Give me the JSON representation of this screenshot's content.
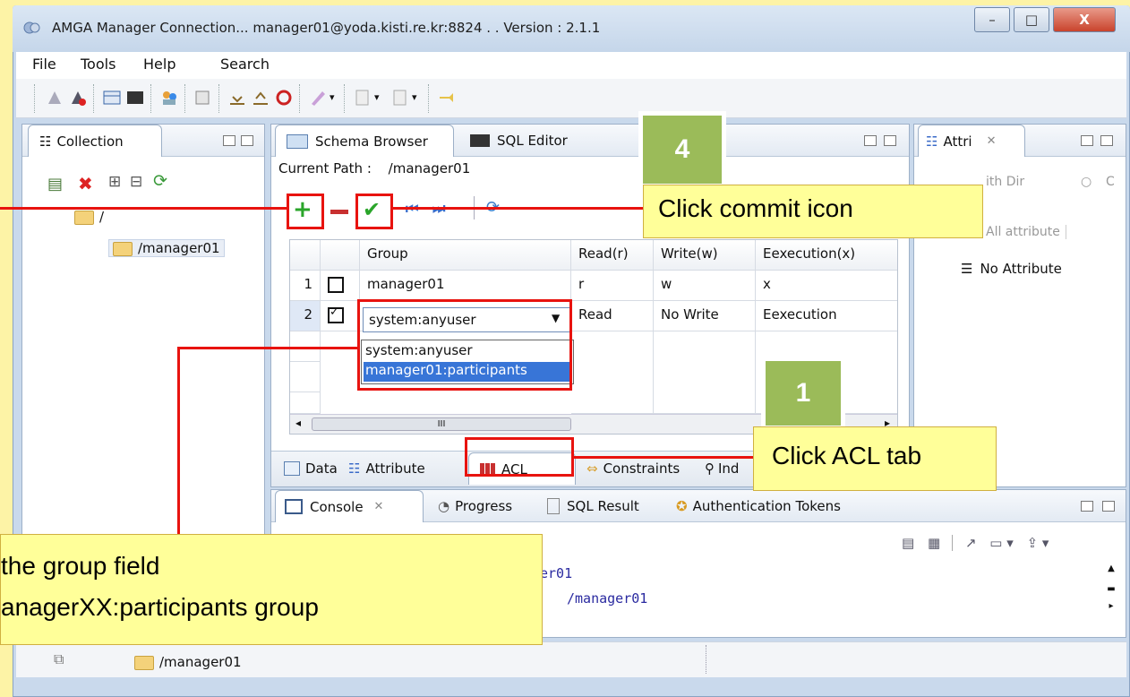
{
  "window": {
    "title": "AMGA Manager Connection... manager01@yoda.kisti.re.kr:8824 . . Version : 2.1.1",
    "minimize": "–",
    "maximize": "□",
    "close": "X"
  },
  "menu": {
    "file": "File",
    "tools": "Tools",
    "help": "Help",
    "search": "Search"
  },
  "collection": {
    "tab": "Collection",
    "root": "/",
    "child": "/manager01"
  },
  "editor": {
    "tabs": {
      "schema": "Schema Browser",
      "sql": "SQL Editor"
    },
    "current_path_label": "Current Path :",
    "current_path_value": "/manager01",
    "columns": [
      "Group",
      "Read(r)",
      "Write(w)",
      "Eexecution(x)"
    ],
    "rows": [
      {
        "num": "1",
        "checked": false,
        "group": "manager01",
        "read": "r",
        "write": "w",
        "exec": "x"
      },
      {
        "num": "2",
        "checked": true,
        "group": "system:anyuser",
        "read": "Read",
        "write": "No Write",
        "exec": "Eexecution"
      }
    ],
    "dropdown_options": [
      "system:anyuser",
      "manager01:participants"
    ],
    "scroll_marker": "III",
    "bottom_tabs": {
      "data": "Data",
      "attribute": "Attribute",
      "acl": "ACL",
      "constraints": "Constraints",
      "index": "Ind"
    }
  },
  "attri": {
    "tab": "Attri",
    "with_dir": "ith Dir",
    "c_label": "C",
    "all_attribute": "All attribute",
    "no_attribute": "No Attribute"
  },
  "console": {
    "tabs": {
      "console": "Console",
      "progress": "Progress",
      "sql_result": "SQL Result",
      "auth": "Authentication Tokens"
    },
    "line1": "er01",
    "line2": "/manager01"
  },
  "status": {
    "path": "/manager01"
  },
  "callouts": {
    "step4_badge": "4",
    "step4_text": "Click commit icon",
    "step1_badge": "1",
    "step1_text": "Click ACL tab",
    "group_line1": " the group field",
    "group_line2": "anagerXX:participants group"
  },
  "colors": {
    "callout_bg": "#ffff99",
    "badge": "#9bbb59",
    "highlight": "#e8130f"
  }
}
